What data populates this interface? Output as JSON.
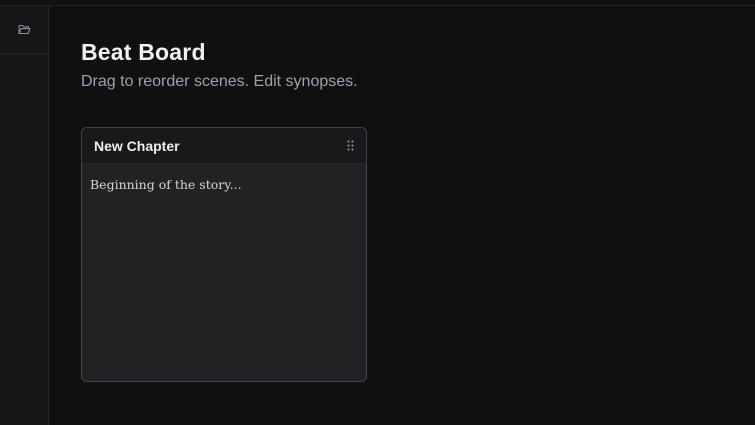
{
  "sidebar": {
    "items": [
      {
        "icon": "folder-open-icon"
      }
    ]
  },
  "header": {
    "title": "Beat Board",
    "subtitle": "Drag to reorder scenes. Edit synopses."
  },
  "cards": [
    {
      "title": "New Chapter",
      "synopsis": "Beginning of the story...",
      "handle_icon": "drag-handle-icon"
    }
  ],
  "colors": {
    "background": "#101011",
    "card_border": "#3b4654",
    "title": "#f2f2f3",
    "subtitle": "#9aa3ae"
  }
}
